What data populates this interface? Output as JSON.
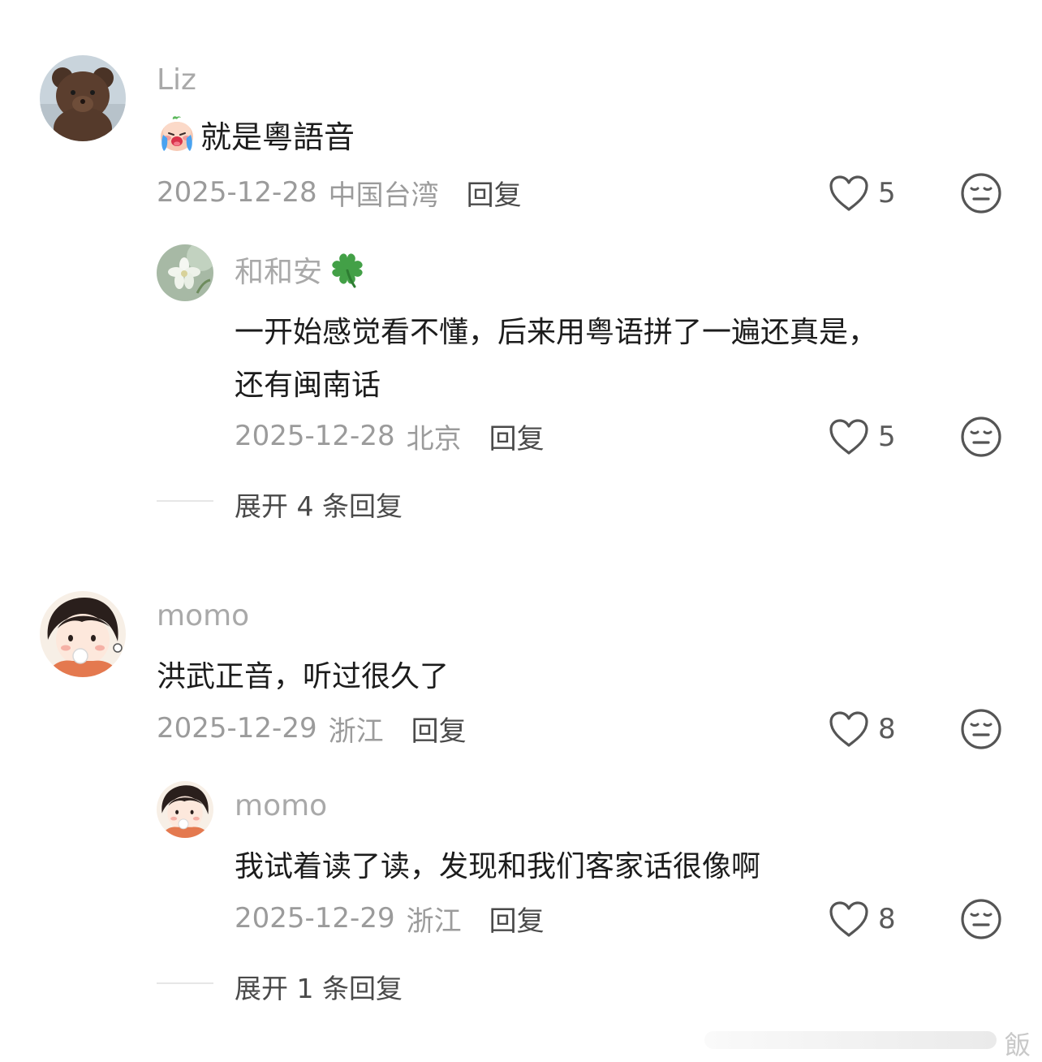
{
  "comments": [
    {
      "name": "Liz",
      "text": "就是粵語音",
      "date": "2025-12-28",
      "location": "中国台湾",
      "reply_label": "回复",
      "likes": "5",
      "icons": [
        "crying-face-emoji"
      ],
      "replies": [
        {
          "name": "和和安",
          "text_line1": "一开始感觉看不懂，后来用粤语拼了一遍还真是，",
          "text_line2": "还有闽南话",
          "date": "2025-12-28",
          "location": "北京",
          "reply_label": "回复",
          "likes": "5",
          "icons": [
            "four-leaf-clover-emoji"
          ]
        }
      ],
      "expand_label": "展开 4 条回复"
    },
    {
      "name": "momo",
      "text": "洪武正音，听过很久了",
      "date": "2025-12-29",
      "location": "浙江",
      "reply_label": "回复",
      "likes": "8",
      "replies": [
        {
          "name": "momo",
          "text": "我试着读了读，发现和我们客家话很像啊",
          "date": "2025-12-29",
          "location": "浙江",
          "reply_label": "回复",
          "likes": "8"
        }
      ],
      "expand_label": "展开 1 条回复"
    }
  ],
  "watermark": "飯",
  "colors": {
    "name": "#a9a9a9",
    "meta": "#9b9b9b",
    "text": "#1c1c1c",
    "icon": "#555555"
  }
}
